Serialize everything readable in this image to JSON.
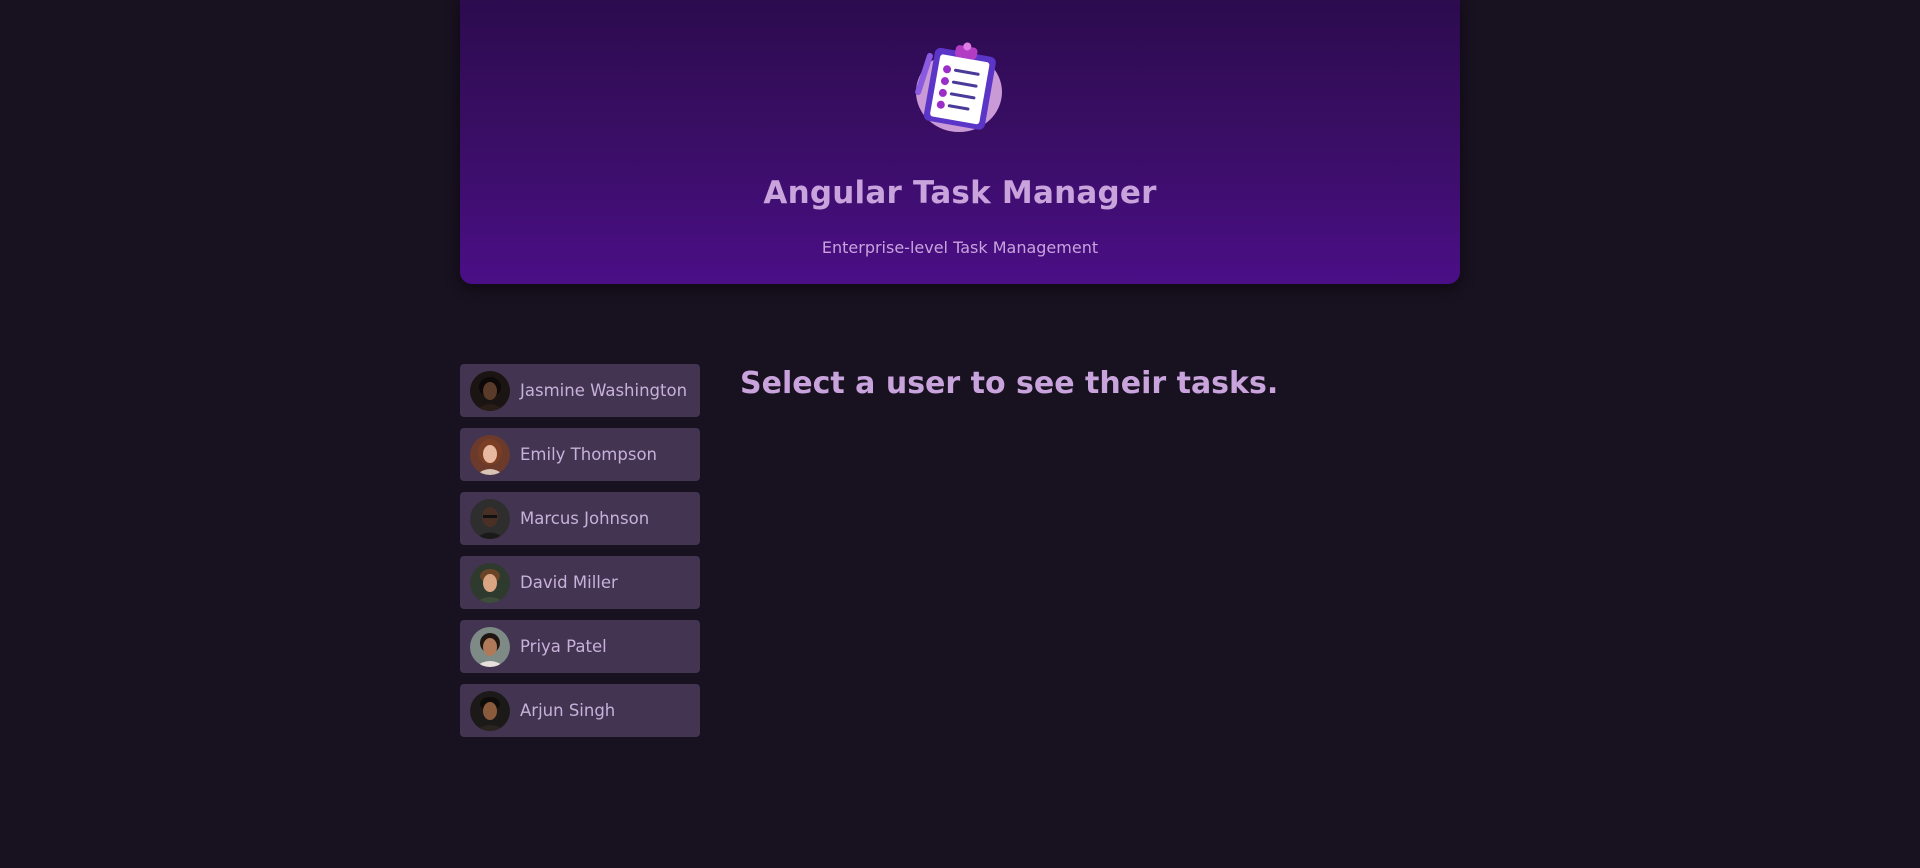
{
  "header": {
    "logo_icon": "task-clipboard-icon",
    "title": "Angular Task Manager",
    "subtitle": "Enterprise-level Task Management"
  },
  "users": [
    {
      "name": "Jasmine Washington",
      "avatar": "user-avatar-jasmine"
    },
    {
      "name": "Emily Thompson",
      "avatar": "user-avatar-emily"
    },
    {
      "name": "Marcus Johnson",
      "avatar": "user-avatar-marcus"
    },
    {
      "name": "David Miller",
      "avatar": "user-avatar-david"
    },
    {
      "name": "Priya Patel",
      "avatar": "user-avatar-priya"
    },
    {
      "name": "Arjun Singh",
      "avatar": "user-avatar-arjun"
    }
  ],
  "main": {
    "fallback_text": "Select a user to see their tasks."
  },
  "colors": {
    "page_background": "#181120",
    "header_gradient_top": "#2c0b4f",
    "header_gradient_bottom": "#4a0e86",
    "accent_text": "#c9a3dc",
    "user_item_background": "#433452"
  }
}
